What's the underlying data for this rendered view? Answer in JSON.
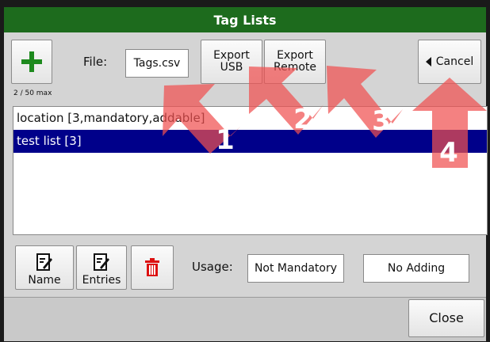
{
  "window": {
    "title": "Tag Lists"
  },
  "toolbar": {
    "add_icon": "plus-icon",
    "count": "2 / 50 max",
    "file_label": "File:",
    "file_value": "Tags.csv",
    "export_usb_line1": "Export",
    "export_usb_line2": "USB",
    "export_remote_line1": "Export",
    "export_remote_line2": "Remote",
    "cancel_label": "Cancel"
  },
  "tag_list": {
    "items": [
      {
        "label": "location [3,mandatory,addable]",
        "selected": false
      },
      {
        "label": "test list [3]",
        "selected": true
      }
    ]
  },
  "bottom_toolbar": {
    "name_label": "Name",
    "entries_label": "Entries",
    "delete_icon": "trash-icon",
    "usage_label": "Usage:",
    "usage_value": "Not Mandatory",
    "adding_value": "No Adding"
  },
  "footer": {
    "close_label": "Close"
  },
  "annotations": {
    "numbers": [
      "1",
      "2",
      "3",
      "4"
    ],
    "arrow_color": "#f05050"
  },
  "colors": {
    "title_bar": "#1d6b1d",
    "selection": "#00008a",
    "add_icon": "#1e8a1e",
    "delete_icon": "#dd1111"
  }
}
